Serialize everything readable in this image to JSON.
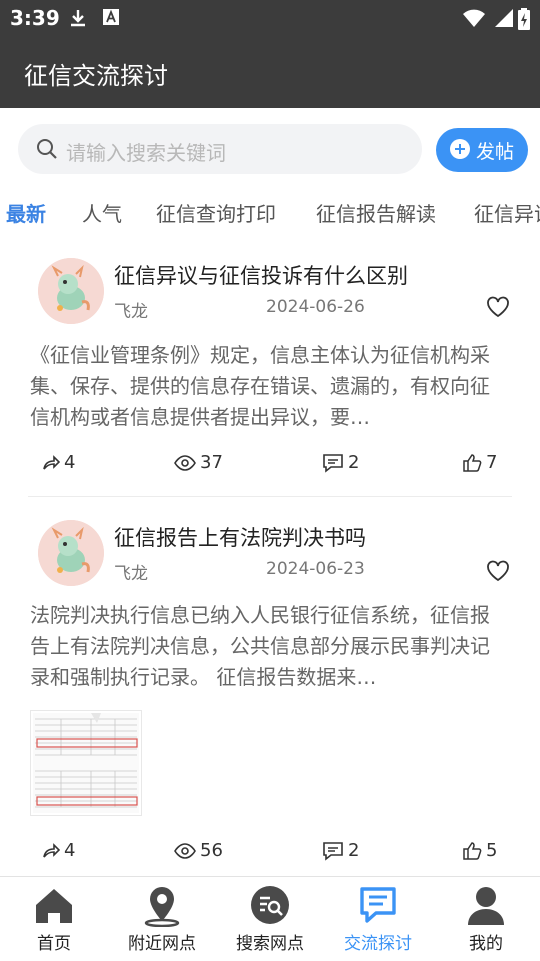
{
  "status_bar": {
    "time": "3:39"
  },
  "app_bar": {
    "title": "征信交流探讨"
  },
  "search": {
    "placeholder": "请输入搜索关键词"
  },
  "post_button": {
    "label": "发帖"
  },
  "tabs": [
    "最新",
    "人气",
    "征信查询打印",
    "征信报告解读",
    "征信异议"
  ],
  "posts": [
    {
      "title": "征信异议与征信投诉有什么区别",
      "author": "飞龙",
      "date": "2024-06-26",
      "excerpt": "《征信业管理条例》规定，信息主体认为征信机构采集、保存、提供的信息存在错误、遗漏的，有权向征信机构或者信息提供者提出异议，要…",
      "shares": "4",
      "views": "37",
      "comments": "2",
      "likes": "7"
    },
    {
      "title": "征信报告上有法院判决书吗",
      "author": "飞龙",
      "date": "2024-06-23",
      "excerpt": "法院判决执行信息已纳入人民银行征信系统，征信报告上有法院判决信息，公共信息部分展示民事判决记录和强制执行记录。 征信报告数据来…",
      "shares": "4",
      "views": "56",
      "comments": "2",
      "likes": "5"
    }
  ],
  "bottom_nav": [
    "首页",
    "附近网点",
    "搜索网点",
    "交流探讨",
    "我的"
  ],
  "colors": {
    "accent": "#3b93f5",
    "header": "#3c3c3c"
  }
}
